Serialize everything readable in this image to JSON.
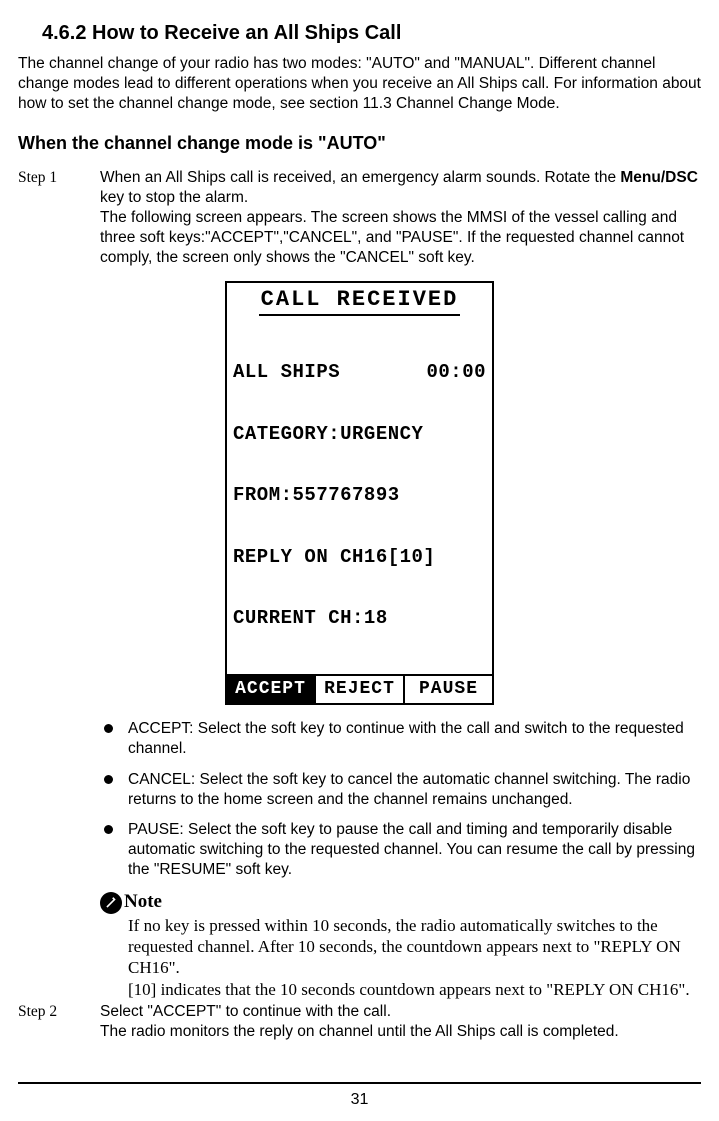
{
  "heading": "4.6.2 How to Receive an All Ships Call",
  "intro": "The channel change of your radio has two modes: \"AUTO\" and \"MANUAL\". Different channel change modes lead to different operations when you receive an All Ships call. For information about how to set the channel change mode, see section 11.3 Channel Change Mode.",
  "subheading": "When the channel change mode is \"AUTO\"",
  "step1": {
    "label": "Step 1",
    "p1": "When an All Ships call is received, an emergency alarm sounds. Rotate the ",
    "p1b": "Menu/DSC",
    "p1c": " key to stop the alarm.",
    "p2": "The following screen appears. The screen shows the MMSI of the vessel calling and three soft keys:\"ACCEPT\",\"CANCEL\", and \"PAUSE\". If the requested channel cannot comply, the screen only shows the \"CANCEL\" soft key."
  },
  "lcd": {
    "title": "CALL RECEIVED",
    "row1a": "ALL SHIPS",
    "row1b": "00:00",
    "row2": "CATEGORY:URGENCY",
    "row3": "FROM:557767893",
    "row4": "REPLY ON CH16[10]",
    "row5": "CURRENT CH:18",
    "sk1": "ACCEPT",
    "sk2": "REJECT",
    "sk3": "PAUSE"
  },
  "bullets": {
    "b1": "ACCEPT: Select the soft key to continue with the call and switch to the requested channel.",
    "b2": "CANCEL: Select the soft key to cancel the automatic channel switching. The radio returns to the home screen and the channel remains unchanged.",
    "b3": "PAUSE: Select the soft key to pause the call and timing and temporarily disable automatic switching to the requested channel. You can resume the call by pressing the \"RESUME\" soft key."
  },
  "note": {
    "label": "Note",
    "l1": "If no key is pressed within 10 seconds, the radio automatically switches to the requested channel. After 10 seconds, the countdown appears next to \"REPLY ON CH16\".",
    "l2": "[10] indicates that the 10 seconds countdown appears next to \"REPLY ON CH16\"."
  },
  "step2": {
    "label": "Step 2",
    "p1": "Select \"ACCEPT\" to continue with the call.",
    "p2": "The radio monitors the reply on channel until the All Ships call is completed."
  },
  "pagenum": "31"
}
